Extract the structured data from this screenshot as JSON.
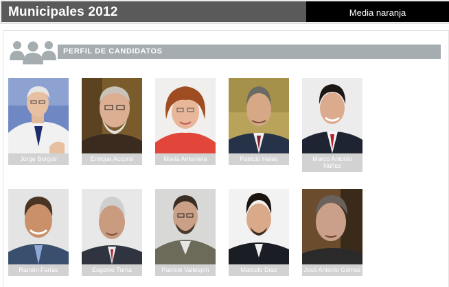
{
  "header": {
    "title": "Municipales 2012",
    "brand": "Media naranja"
  },
  "section": {
    "title": "PERFIL DE CANDIDATOS",
    "icon": "people-group-icon"
  },
  "candidates": [
    {
      "name": "Jorge Burgos"
    },
    {
      "name": "Enrique Accorsi"
    },
    {
      "name": "María Antonieta"
    },
    {
      "name": "Patricio Hales"
    },
    {
      "name": "Marco Antonio Núñez"
    },
    {
      "name": "Ramón Farías"
    },
    {
      "name": "Eugenio Tuma"
    },
    {
      "name": "Patricio Vallespín"
    },
    {
      "name": "Marcelo Díaz"
    },
    {
      "name": "José Antonio Gómez"
    }
  ],
  "colors": {
    "title_bar": "#5a5a5a",
    "brand_bar": "#000000",
    "section_band": "#a5adb1",
    "name_band": "#d2d2d2"
  }
}
